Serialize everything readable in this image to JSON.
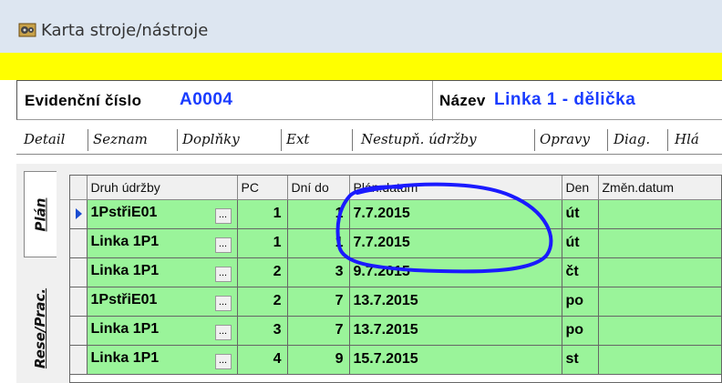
{
  "window": {
    "title": "Karta stroje/nástroje",
    "icon": "machine-gear-icon"
  },
  "ident": {
    "evid_label": "Evidenční číslo",
    "evid_value": "A0004",
    "nazev_label": "Název",
    "nazev_value": "Linka 1 - dělička"
  },
  "tabs": [
    "Detail",
    "Seznam",
    "Doplňky",
    "Ext",
    "Nestupň. údržby",
    "Opravy",
    "Diag.",
    "Hlá"
  ],
  "side_tabs": [
    "Plán",
    "Rese/Prac."
  ],
  "table": {
    "columns": [
      "Druh údržby",
      "PC",
      "Dní do",
      "Plán.datum",
      "Den",
      "Změn.datum"
    ],
    "rows": [
      {
        "druh": "1PstřiE01",
        "pc": "1",
        "dni": "1",
        "datum": "7.7.2015",
        "den": "út",
        "zmen": ""
      },
      {
        "druh": "Linka 1P1",
        "pc": "1",
        "dni": "1",
        "datum": "7.7.2015",
        "den": "út",
        "zmen": ""
      },
      {
        "druh": "Linka 1P1",
        "pc": "2",
        "dni": "3",
        "datum": "9.7.2015",
        "den": "čt",
        "zmen": ""
      },
      {
        "druh": "1PstřiE01",
        "pc": "2",
        "dni": "7",
        "datum": "13.7.2015",
        "den": "po",
        "zmen": ""
      },
      {
        "druh": "Linka 1P1",
        "pc": "3",
        "dni": "7",
        "datum": "13.7.2015",
        "den": "po",
        "zmen": ""
      },
      {
        "druh": "Linka 1P1",
        "pc": "4",
        "dni": "9",
        "datum": "15.7.2015",
        "den": "st",
        "zmen": ""
      }
    ],
    "ellipsis": "..."
  },
  "colors": {
    "row_green": "#9af49a",
    "highlight_yellow": "#ffff00",
    "annotation_blue": "#1a1aff",
    "value_blue": "#1a3cff"
  }
}
